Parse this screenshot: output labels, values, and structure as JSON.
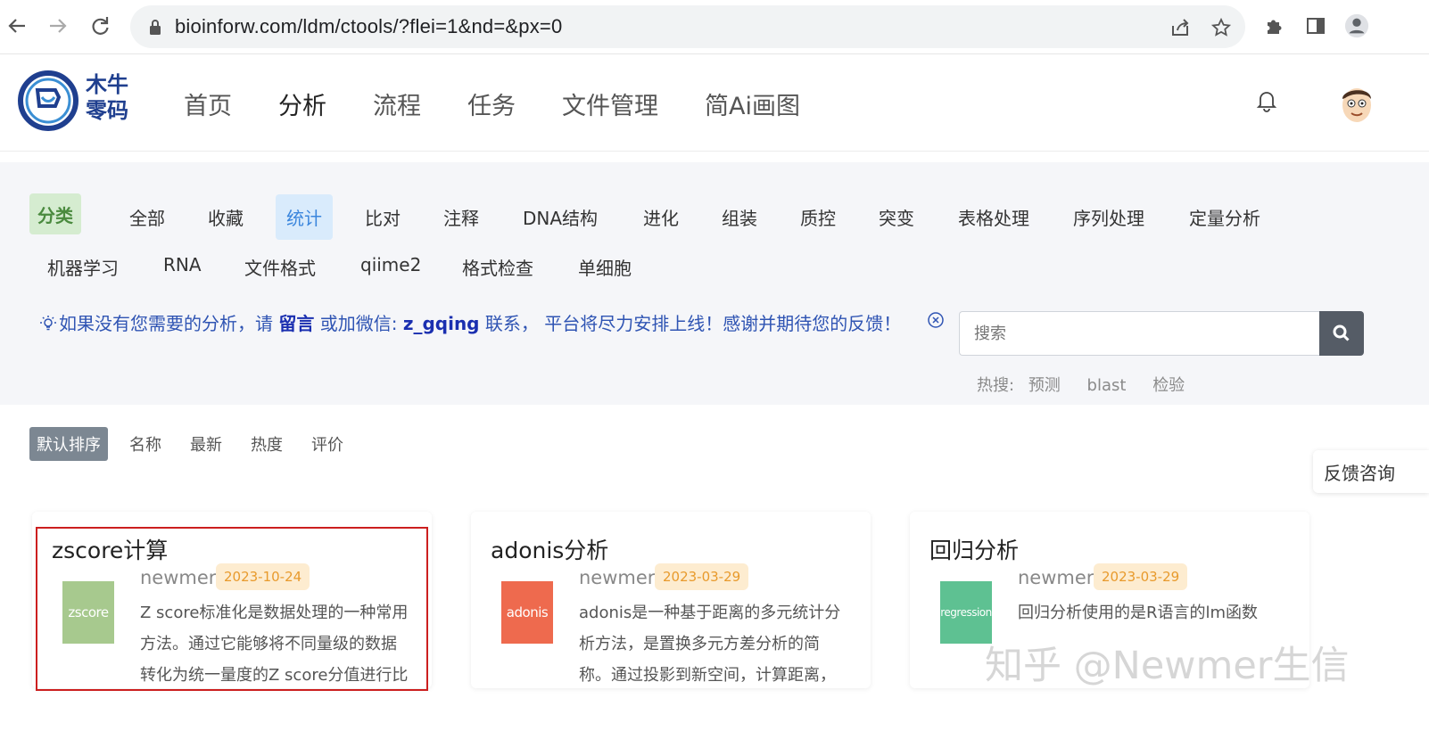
{
  "browser": {
    "url": "bioinforw.com/ldm/ctools/?flei=1&nd=&px=0"
  },
  "site": {
    "logo_line1": "木牛",
    "logo_line2": "零码",
    "nav": [
      {
        "label": "首页"
      },
      {
        "label": "分析"
      },
      {
        "label": "流程"
      },
      {
        "label": "任务"
      },
      {
        "label": "文件管理"
      },
      {
        "label": "简Ai画图"
      }
    ]
  },
  "filters": {
    "label": "分类",
    "row1": [
      "全部",
      "收藏",
      "统计",
      "比对",
      "注释",
      "DNA结构",
      "进化",
      "组装",
      "质控",
      "突变",
      "表格处理",
      "序列处理",
      "定量分析"
    ],
    "row2": [
      "机器学习",
      "RNA",
      "文件格式",
      "qiime2",
      "格式检查",
      "单细胞"
    ],
    "active": "统计"
  },
  "notice": {
    "part1": "如果没有您需要的分析，请 ",
    "link": "留言",
    "part2": " 或加微信: ",
    "wechat": "z_gqing",
    "part3": " 联系， 平台将尽力安排上线！感谢并期待您的反馈！"
  },
  "search": {
    "placeholder": "搜索",
    "hot_label": "热搜:",
    "hot": [
      "预测",
      "blast",
      "检验"
    ]
  },
  "sort": {
    "options": [
      "默认排序",
      "名称",
      "最新",
      "热度",
      "评价"
    ]
  },
  "feedback_label": "反馈咨询",
  "cards": [
    {
      "title": "zscore计算",
      "thumb_text": "zscore",
      "thumb_color": "#a7c98e",
      "author": "newmer",
      "date": "2023-10-24",
      "desc": "Z score标准化是数据处理的一种常用方法。通过它能够将不同量级的数据转化为统一量度的Z score分值进行比"
    },
    {
      "title": "adonis分析",
      "thumb_text": "adonis",
      "thumb_color": "#ee6a4e",
      "author": "newmer",
      "date": "2023-03-29",
      "desc": "adonis是一种基于距离的多元统计分析方法，是置换多元方差分析的简称。通过投影到新空间，计算距离，从而确"
    },
    {
      "title": "回归分析",
      "thumb_text": "regression",
      "thumb_color": "#5ec192",
      "author": "newmer",
      "date": "2023-03-29",
      "desc": "回归分析使用的是R语言的lm函数"
    }
  ],
  "watermark": "知乎 @Newmer生信"
}
